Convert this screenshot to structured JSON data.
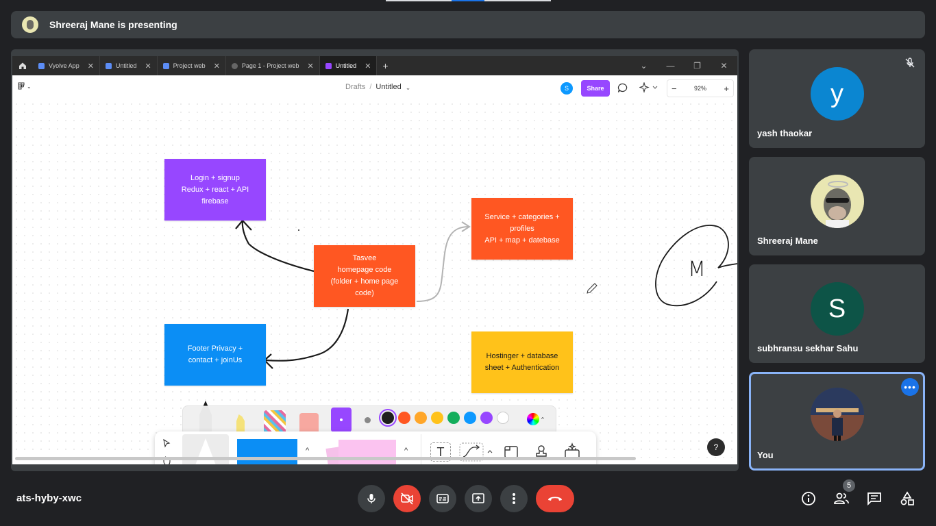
{
  "banner": {
    "text": "Shreeraj Mane is presenting"
  },
  "browser": {
    "tabs": [
      {
        "label": "Vyolve App",
        "icon": "figma-file-icon"
      },
      {
        "label": "Untitled",
        "icon": "figma-file-icon"
      },
      {
        "label": "Project web",
        "icon": "figma-file-icon"
      },
      {
        "label": "Page 1 - Project web",
        "icon": "play-icon"
      },
      {
        "label": "Untitled",
        "icon": "figjam-file-icon",
        "active": true
      }
    ]
  },
  "figma": {
    "breadcrumb_parent": "Drafts",
    "breadcrumb_sep": "/",
    "file_name": "Untitled",
    "avatar_letter": "S",
    "share_label": "Share",
    "zoom": "92%",
    "zoom_minus": "−",
    "zoom_plus": "+",
    "help": "?"
  },
  "board": {
    "stickies": [
      {
        "id": "login",
        "text": "Login + signup\nRedux + react + API\nfirebase",
        "color": "#9747ff"
      },
      {
        "id": "tasvee",
        "text": "Tasvee\nhomepage code\n(folder + home page\ncode)",
        "color": "#ff5722"
      },
      {
        "id": "service",
        "text": "Service + categories +\nprofiles\nAPI + map + datebase",
        "color": "#ff5722"
      },
      {
        "id": "footer",
        "text": "Footer Privacy +\ncontact + joinUs",
        "color": "#0b8ef5"
      },
      {
        "id": "hostinger",
        "text": "Hostinger + database\nsheet + Authentication",
        "color": "#ffc21a"
      }
    ],
    "handwriting": "M"
  },
  "colors": [
    "#1e1e1e",
    "#ff5722",
    "#ffa629",
    "#ffc21a",
    "#14ae5c",
    "#0d99ff",
    "#9747ff",
    "#ffffff"
  ],
  "participants": [
    {
      "name": "yash thaokar",
      "initial": "y",
      "avatar_color": "#0b86d1",
      "muted": true
    },
    {
      "name": "Shreeraj Mane",
      "initial": "",
      "avatar_color": "#e9e6b2"
    },
    {
      "name": "subhransu sekhar Sahu",
      "initial": "S",
      "avatar_color": "#0d5447"
    },
    {
      "name": "You",
      "initial": "",
      "avatar_color": "#3a4f7a"
    }
  ],
  "meeting": {
    "code": "ats-hyby-xwc",
    "people_count": "5"
  }
}
